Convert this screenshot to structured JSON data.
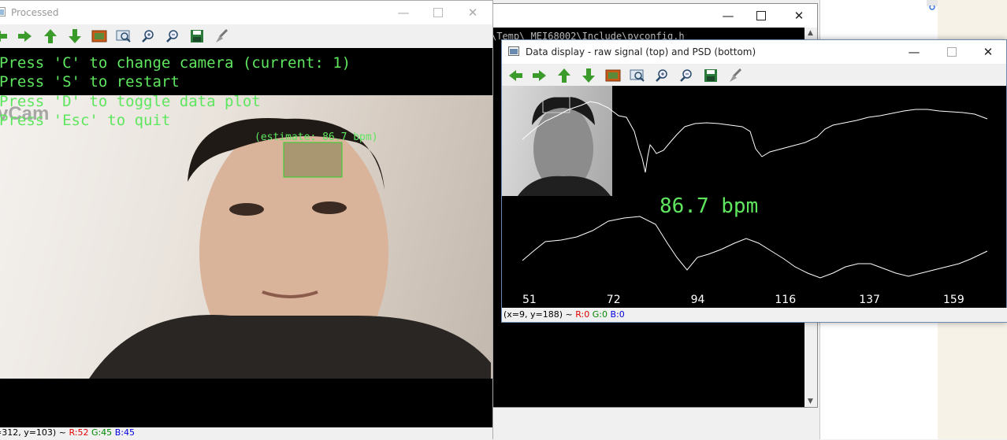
{
  "processed": {
    "title": "Processed",
    "overlay_lines": [
      "Press 'C' to change camera (current: 1)",
      "Press 'S' to restart",
      "Press 'D' to toggle data plot",
      "Press 'Esc' to quit"
    ],
    "watermark": "vCam",
    "estimate_label": "(estimate: 86.7 bpm)",
    "status": {
      "coords": "=312, y=103) ~",
      "r": "R:52",
      "g": "G:45",
      "b": "B:45"
    }
  },
  "console": {
    "path_text": "\\Temp\\_MEI68002\\Include\\pyconfig.h"
  },
  "data_display": {
    "title": "Data display - raw signal (top) and PSD (bottom)",
    "bpm_text": "86.7 bpm",
    "status": {
      "coords": "(x=9, y=188) ~",
      "r": "R:0",
      "g": "G:0",
      "b": "B:0"
    }
  },
  "chart_data": {
    "type": "line",
    "psd": {
      "x_ticks": [
        "51",
        "72",
        "94",
        "116",
        "137",
        "159"
      ]
    }
  },
  "toolbar_icons": [
    "pan-left-icon",
    "pan-right-icon",
    "pan-up-icon",
    "pan-down-icon",
    "zoom-image-icon",
    "zoom-fit-icon",
    "zoom-in-icon",
    "zoom-out-icon",
    "save-icon",
    "properties-icon"
  ],
  "colors": {
    "overlay_green": "#5ee65e",
    "plot_white": "#ffffff",
    "status_red": "#e00000",
    "status_green": "#008a00",
    "status_blue": "#0000e0"
  }
}
